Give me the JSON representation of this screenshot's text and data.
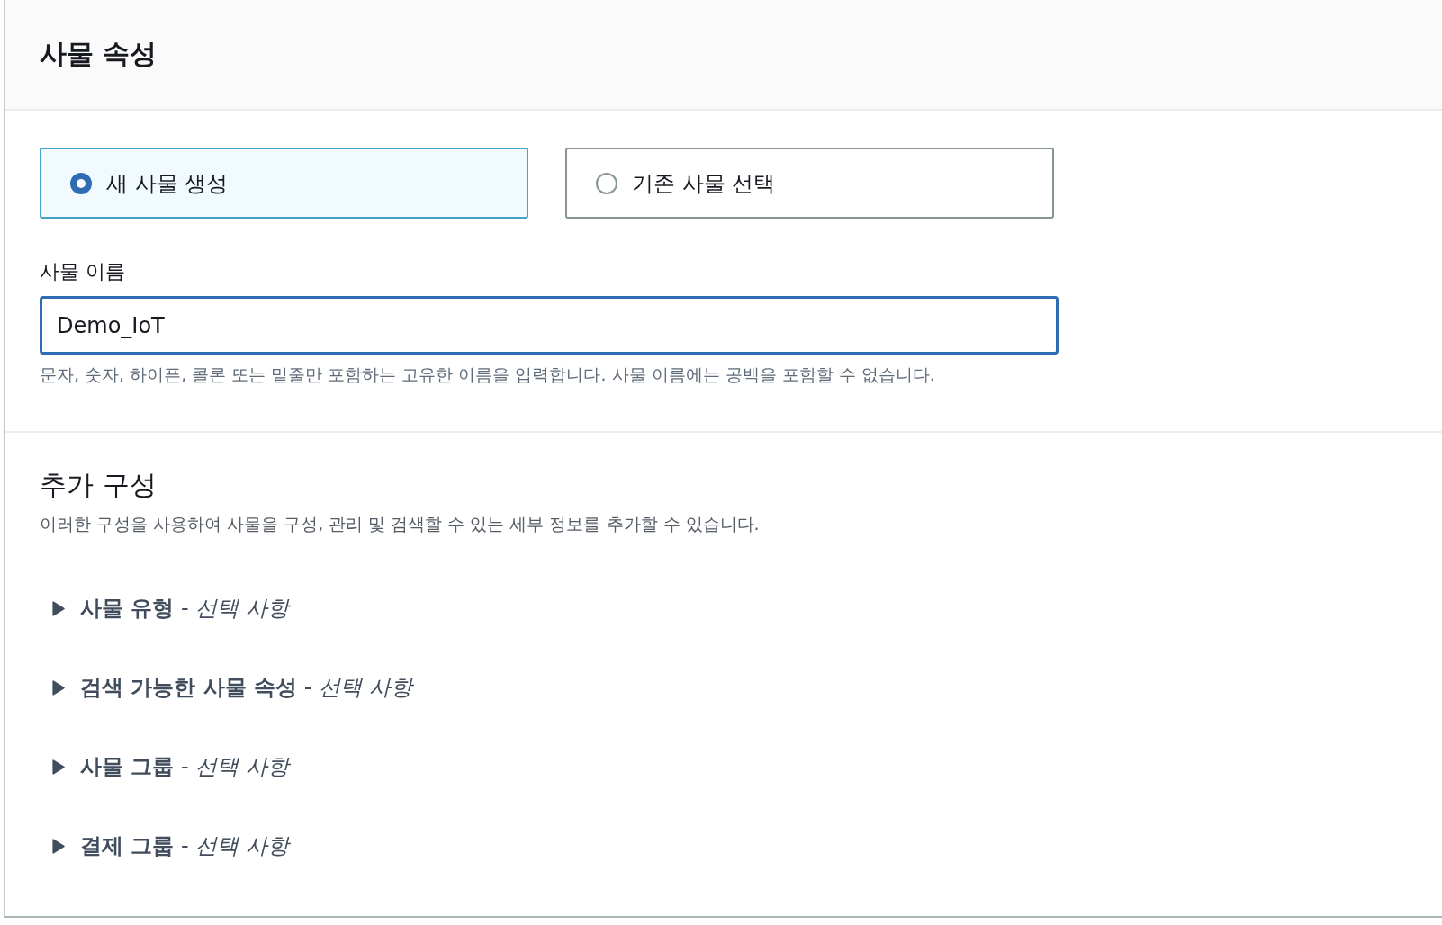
{
  "panel": {
    "title": "사물 속성"
  },
  "options": [
    {
      "label": "새 사물 생성",
      "selected": true
    },
    {
      "label": "기존 사물 선택",
      "selected": false
    }
  ],
  "name_field": {
    "label": "사물 이름",
    "value": "Demo_IoT",
    "hint": "문자, 숫자, 하이픈, 콜론 또는 밑줄만 포함하는 고유한 이름을 입력합니다. 사물 이름에는 공백을 포함할 수 없습니다."
  },
  "additional": {
    "title": "추가 구성",
    "description": "이러한 구성을 사용하여 사물을 구성, 관리 및 검색할 수 있는 세부 정보를 추가할 수 있습니다.",
    "sections": [
      {
        "label": "**사물 유형** - *선택 사항*",
        "expanded": false
      },
      {
        "label": "**검색 가능한 사물 속성** - *선택 사항*",
        "expanded": false
      },
      {
        "label": "**사물 그룹** - *선택 사항*",
        "expanded": false
      },
      {
        "label": "**결제 그룹** - *선택 사항*",
        "expanded": false
      }
    ]
  }
}
